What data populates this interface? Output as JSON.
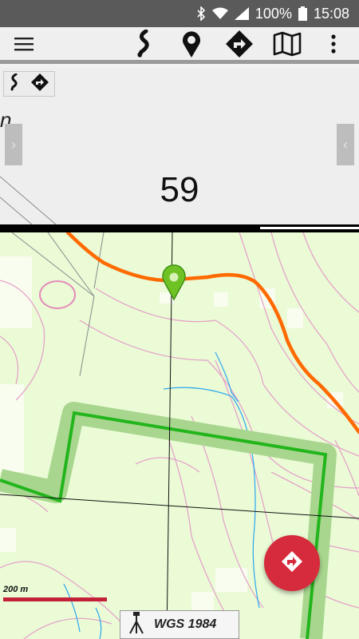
{
  "status_bar": {
    "battery": "100%",
    "time": "15:08",
    "icons": [
      "bluetooth-icon",
      "wifi-icon",
      "signal-icon",
      "battery-icon"
    ]
  },
  "toolbar": {
    "icons": [
      "menu-icon",
      "route-icon",
      "location-pin-icon",
      "directions-icon",
      "map-icon",
      "more-vert-icon"
    ]
  },
  "panel": {
    "unit_fragment": "n",
    "value": "59"
  },
  "map": {
    "scale_label": "200 m",
    "crs_label": "WGS 1984"
  },
  "colors": {
    "track": "#ff6a00",
    "boundary": "#22b51c",
    "contour": "#e6a3c9",
    "water": "#2da6ee",
    "fab": "#d62b3c",
    "scale": "#c4203a"
  }
}
